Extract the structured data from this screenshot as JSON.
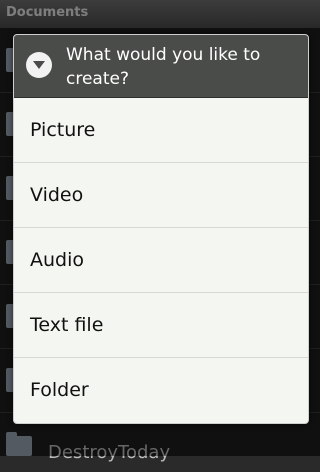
{
  "app": {
    "title": "Documents",
    "partial_item_label": "DestroyToday"
  },
  "dialog": {
    "title": "What would you like to create?",
    "items": [
      {
        "label": "Picture"
      },
      {
        "label": "Video"
      },
      {
        "label": "Audio"
      },
      {
        "label": "Text file"
      },
      {
        "label": "Folder"
      }
    ]
  },
  "colors": {
    "dialog_header": "#4a4c49",
    "dialog_body": "#f4f6f1",
    "divider": "#d7d7d7"
  },
  "icons": {
    "dialog_icon": "dropdown-circle-icon",
    "folder_icon": "folder-icon"
  }
}
